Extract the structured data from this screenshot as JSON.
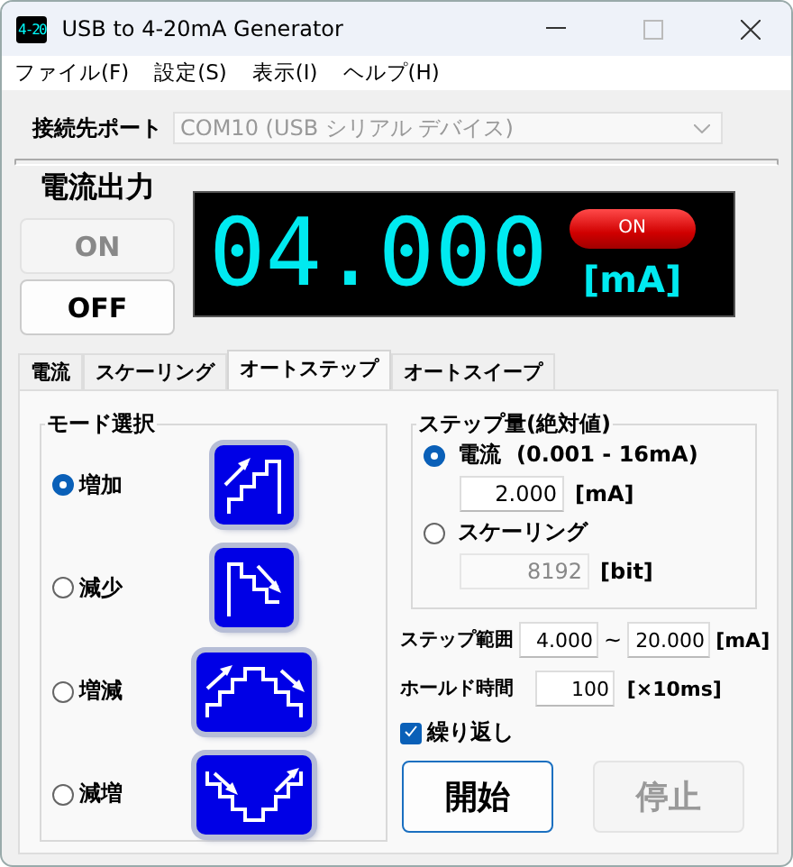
{
  "window": {
    "icon_text": "4-20",
    "title": "USB to 4-20mA Generator"
  },
  "menu": [
    "ファイル(F)",
    "設定(S)",
    "表示(I)",
    "ヘルプ(H)"
  ],
  "port": {
    "label": "接続先ポート",
    "value": "COM10 (USB シリアル デバイス)",
    "disabled": true
  },
  "output": {
    "label": "電流出力",
    "buttons": [
      {
        "label": "ON",
        "disabled": true
      },
      {
        "label": "OFF",
        "disabled": false
      }
    ],
    "reading": "04.000",
    "unit": "[mA]",
    "indicator": {
      "label": "ON",
      "on": true
    }
  },
  "tabs": [
    {
      "label": "電流",
      "selected": false
    },
    {
      "label": "スケーリング",
      "selected": false
    },
    {
      "label": "オートステップ",
      "selected": true
    },
    {
      "label": "オートスイープ",
      "selected": false
    }
  ],
  "mode": {
    "title": "モード選択",
    "items": [
      {
        "label": "増加",
        "selected": true,
        "kind": "up"
      },
      {
        "label": "減少",
        "selected": false,
        "kind": "down"
      },
      {
        "label": "増減",
        "selected": false,
        "kind": "updown"
      },
      {
        "label": "減増",
        "selected": false,
        "kind": "downup"
      }
    ]
  },
  "step_amount": {
    "title": "ステップ量(絶対値)",
    "options": [
      {
        "label": "電流",
        "range": "(0.001 - 16mA)",
        "selected": true,
        "value": "2.000",
        "unit": "[mA]",
        "disabled": false
      },
      {
        "label": "スケーリング",
        "selected": false,
        "value": "8192",
        "unit": "[bit]",
        "disabled": true
      }
    ]
  },
  "step_range": {
    "label": "ステップ範囲",
    "from": "4.000",
    "separator": "~",
    "to": "20.000",
    "unit": "[mA]"
  },
  "hold_time": {
    "label": "ホールド時間",
    "value": "100",
    "unit": "[×10ms]"
  },
  "repeat": {
    "label": "繰り返し",
    "checked": true
  },
  "actions": [
    {
      "label": "開始",
      "disabled": false
    },
    {
      "label": "停止",
      "disabled": true
    }
  ]
}
